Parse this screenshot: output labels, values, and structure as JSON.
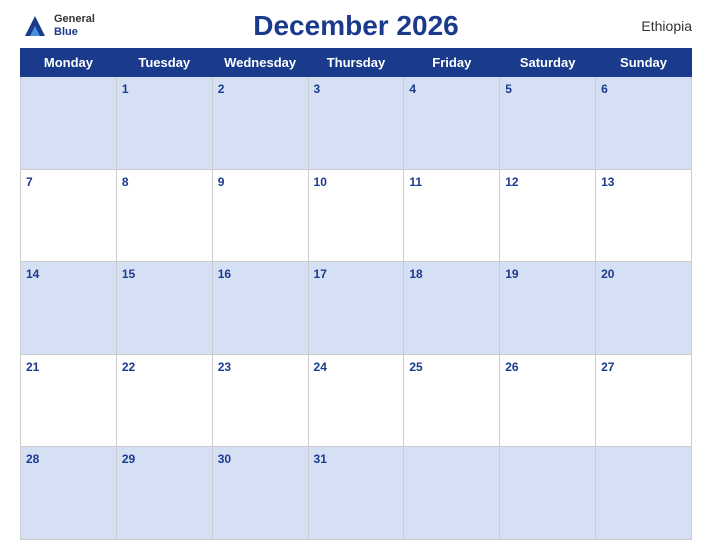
{
  "header": {
    "logo_general": "General",
    "logo_blue": "Blue",
    "title": "December 2026",
    "country": "Ethiopia"
  },
  "days_of_week": [
    "Monday",
    "Tuesday",
    "Wednesday",
    "Thursday",
    "Friday",
    "Saturday",
    "Sunday"
  ],
  "weeks": [
    [
      "",
      "1",
      "2",
      "3",
      "4",
      "5",
      "6"
    ],
    [
      "7",
      "8",
      "9",
      "10",
      "11",
      "12",
      "13"
    ],
    [
      "14",
      "15",
      "16",
      "17",
      "18",
      "19",
      "20"
    ],
    [
      "21",
      "22",
      "23",
      "24",
      "25",
      "26",
      "27"
    ],
    [
      "28",
      "29",
      "30",
      "31",
      "",
      "",
      ""
    ]
  ]
}
